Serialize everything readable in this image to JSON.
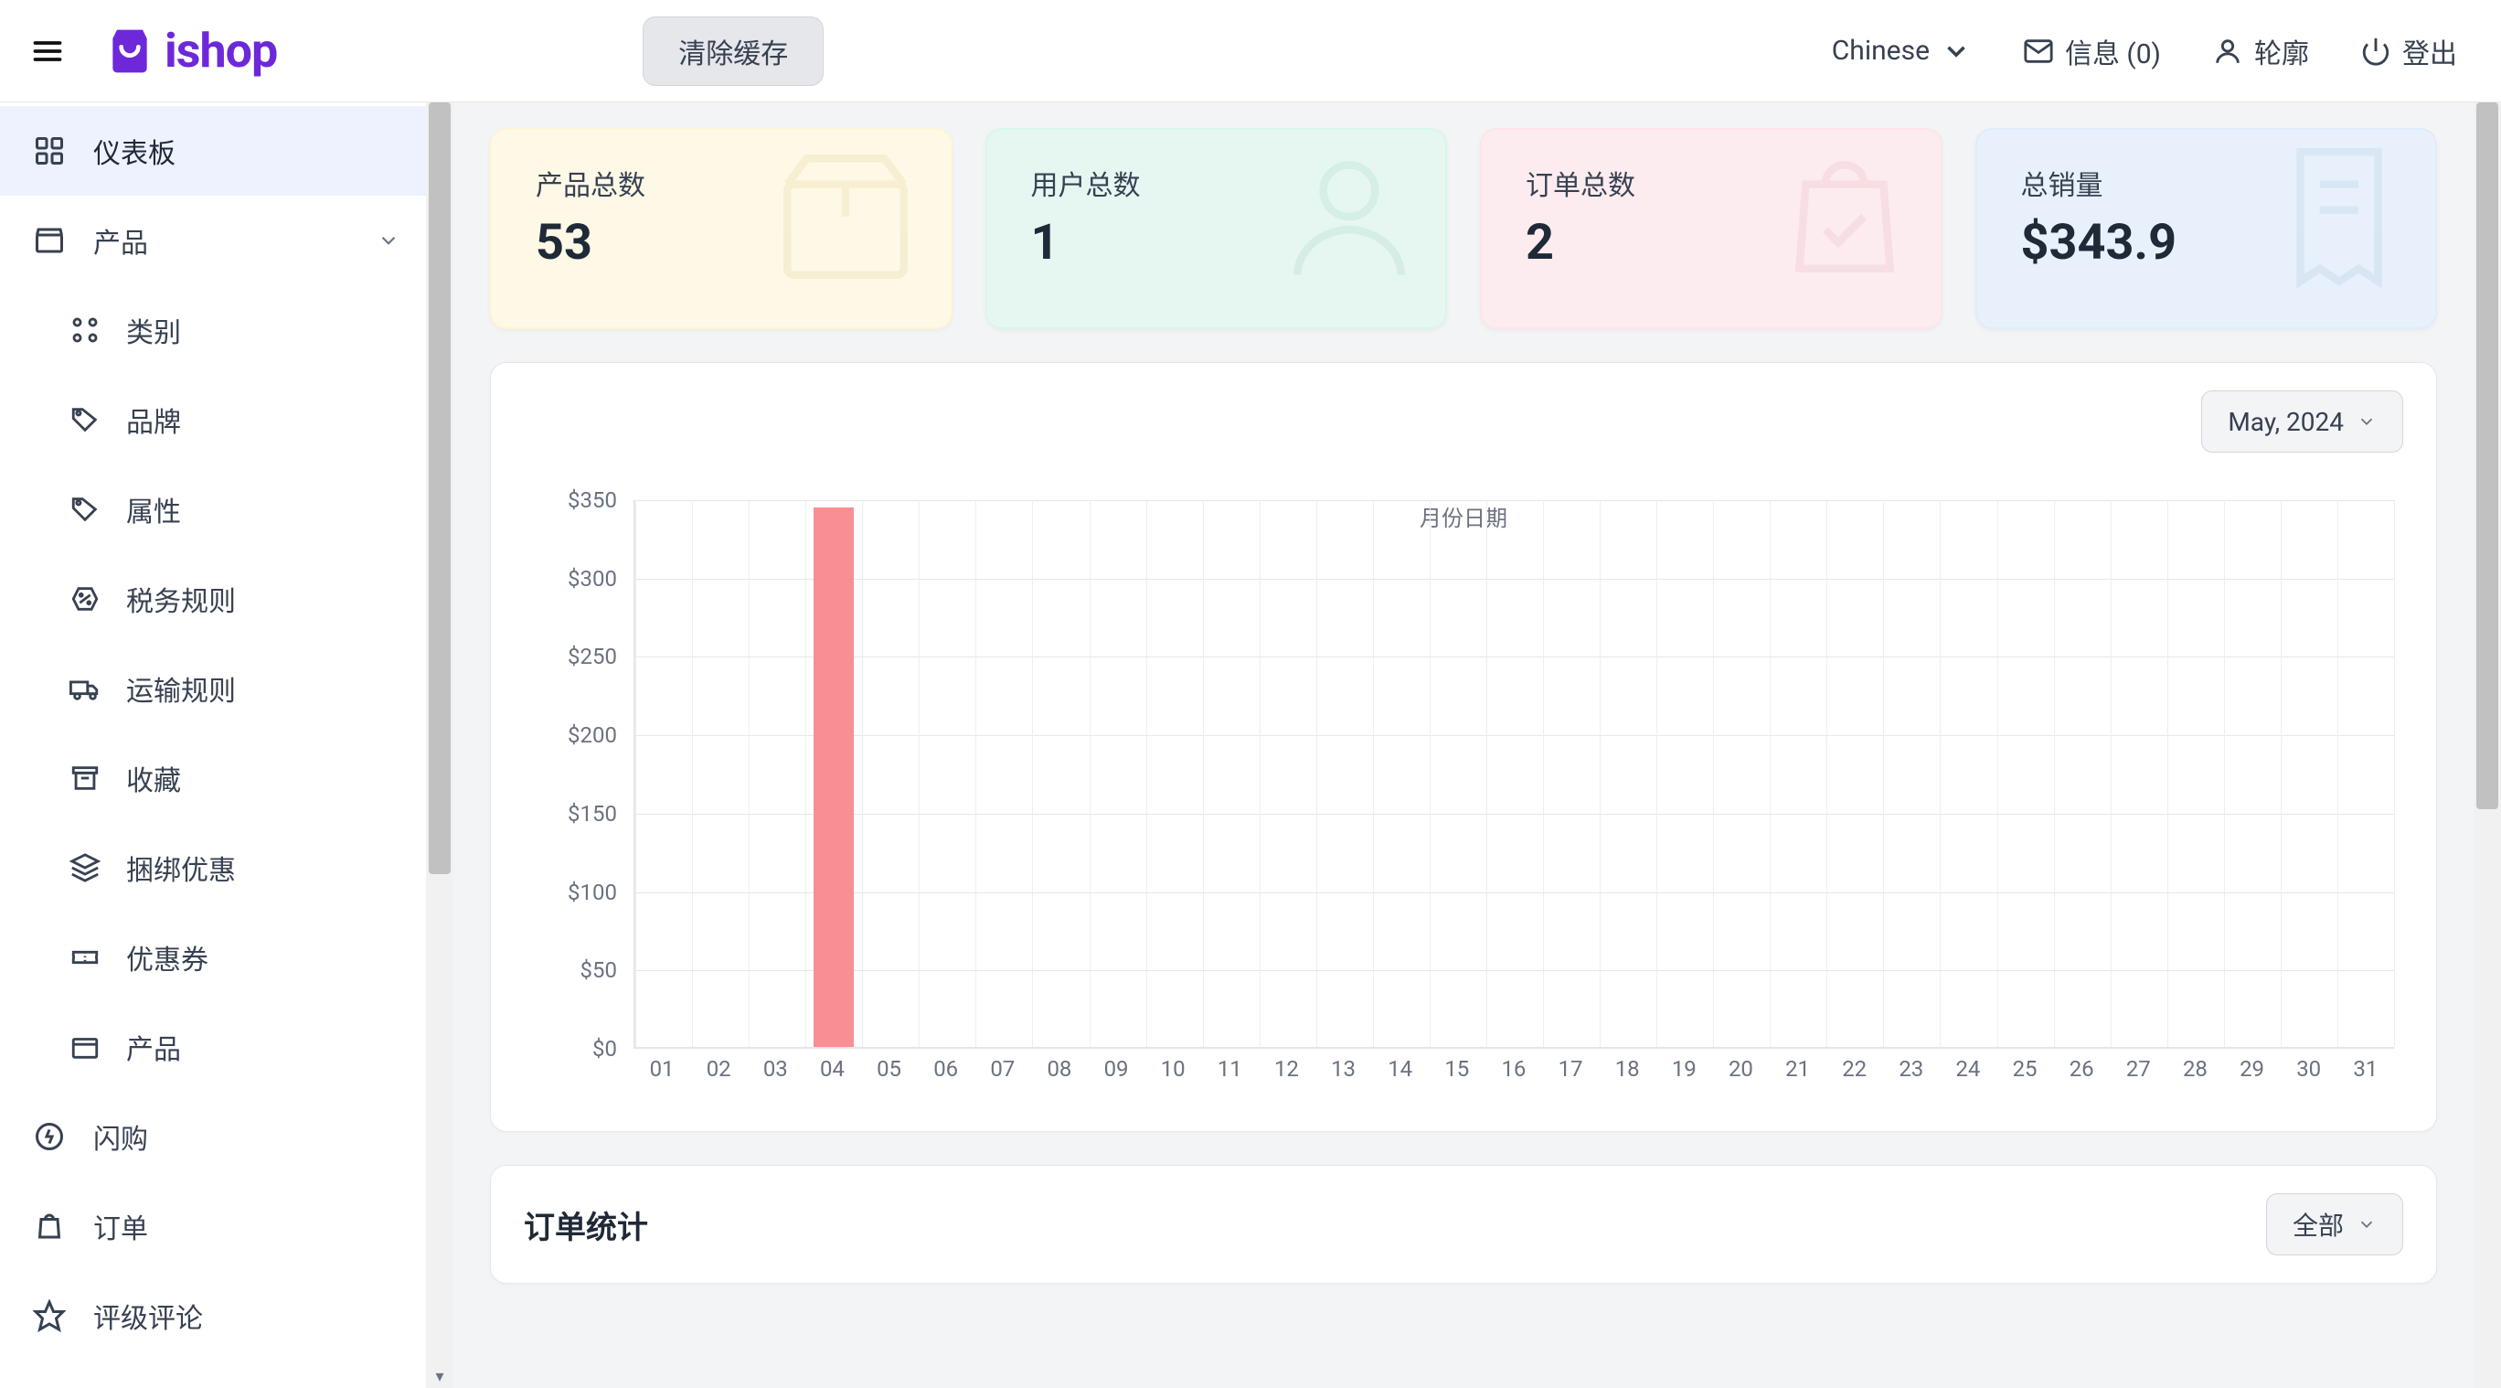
{
  "header": {
    "brand": "ishop",
    "clear_cache_label": "清除缓存",
    "language": "Chinese",
    "messages_label": "信息 (0)",
    "profile_label": "轮廓",
    "logout_label": "登出"
  },
  "sidebar": {
    "items": [
      {
        "label": "仪表板"
      },
      {
        "label": "产品"
      }
    ],
    "product_children": [
      {
        "label": "类别"
      },
      {
        "label": "品牌"
      },
      {
        "label": "属性"
      },
      {
        "label": "税务规则"
      },
      {
        "label": "运输规则"
      },
      {
        "label": "收藏"
      },
      {
        "label": "捆绑优惠"
      },
      {
        "label": "优惠券"
      },
      {
        "label": "产品"
      }
    ],
    "bottom_items": [
      {
        "label": "闪购"
      },
      {
        "label": "订单"
      },
      {
        "label": "评级评论"
      }
    ]
  },
  "stats": {
    "products": {
      "label": "产品总数",
      "value": "53"
    },
    "users": {
      "label": "用户总数",
      "value": "1"
    },
    "orders": {
      "label": "订单总数",
      "value": "2"
    },
    "sales": {
      "label": "总销量",
      "value": "$343.9"
    }
  },
  "sales_chart": {
    "month_selector": "May, 2024",
    "x_title": "月份日期"
  },
  "orders_panel": {
    "title": "订单统计",
    "filter": "全部"
  },
  "chart_data": {
    "type": "bar",
    "categories": [
      "01",
      "02",
      "03",
      "04",
      "05",
      "06",
      "07",
      "08",
      "09",
      "10",
      "11",
      "12",
      "13",
      "14",
      "15",
      "16",
      "17",
      "18",
      "19",
      "20",
      "21",
      "22",
      "23",
      "24",
      "25",
      "26",
      "27",
      "28",
      "29",
      "30",
      "31"
    ],
    "values": [
      0,
      0,
      0,
      343.9,
      0,
      0,
      0,
      0,
      0,
      0,
      0,
      0,
      0,
      0,
      0,
      0,
      0,
      0,
      0,
      0,
      0,
      0,
      0,
      0,
      0,
      0,
      0,
      0,
      0,
      0,
      0
    ],
    "y_ticks": [
      "$0",
      "$50",
      "$100",
      "$150",
      "$200",
      "$250",
      "$300",
      "$350"
    ],
    "ylim": [
      0,
      350
    ],
    "xlabel": "月份日期",
    "ylabel": "",
    "title": ""
  }
}
